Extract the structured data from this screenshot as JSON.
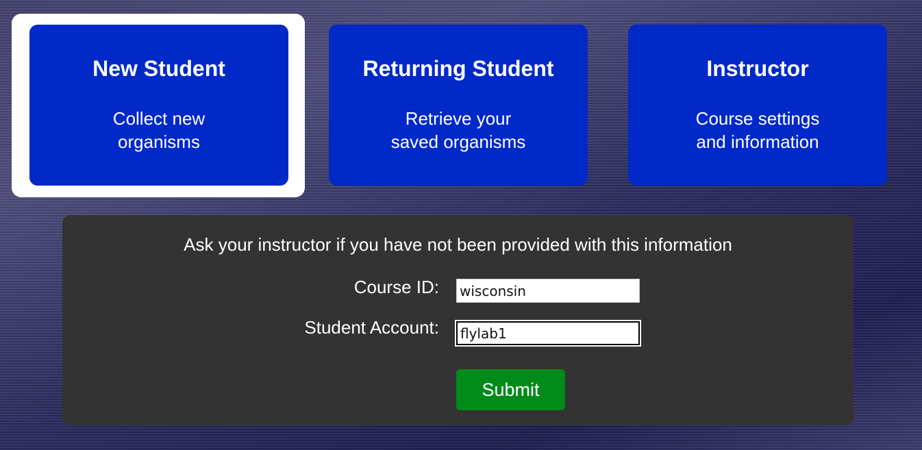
{
  "cards": [
    {
      "title": "New Student",
      "sub_line1": "Collect new",
      "sub_line2": "organisms",
      "selected": true
    },
    {
      "title": "Returning Student",
      "sub_line1": "Retrieve your",
      "sub_line2": "saved organisms",
      "selected": false
    },
    {
      "title": "Instructor",
      "sub_line1": "Course settings",
      "sub_line2": "and information",
      "selected": false
    }
  ],
  "form": {
    "message": "Ask your instructor if you have not been provided with this information",
    "course_id_label": "Course ID:",
    "course_id_value": "wisconsin",
    "student_account_label": "Student Account:",
    "student_account_value": "flylab1",
    "submit_label": "Submit"
  },
  "colors": {
    "card_blue": "#0029c7",
    "panel_gray": "#333333",
    "submit_green": "#008a1a",
    "selection_white": "#ffffff"
  }
}
